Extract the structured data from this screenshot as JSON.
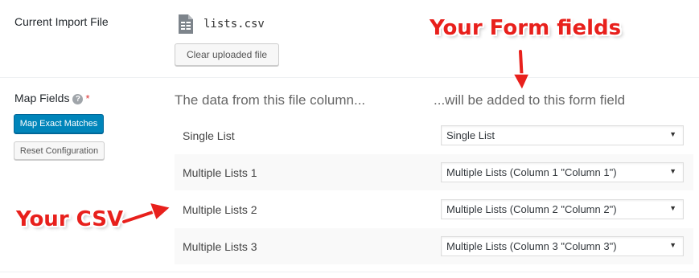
{
  "current_import": {
    "label": "Current Import File",
    "file_icon": "document-icon",
    "file_name": "lists.csv",
    "clear_button": "Clear uploaded file"
  },
  "map_fields": {
    "label": "Map Fields",
    "help_icon": "question-circle-icon",
    "help_glyph": "?",
    "required_marker": "*",
    "map_exact_button": "Map Exact Matches",
    "reset_button": "Reset Configuration",
    "column_header": "The data from this file column...",
    "field_header": "...will be added to this form field",
    "rows": [
      {
        "column": "Single List",
        "field": "Single List"
      },
      {
        "column": "Multiple Lists 1",
        "field": "Multiple Lists (Column 1 \"Column 1\")"
      },
      {
        "column": "Multiple Lists 2",
        "field": "Multiple Lists (Column 2 \"Column 2\")"
      },
      {
        "column": "Multiple Lists 3",
        "field": "Multiple Lists (Column 3 \"Column 3\")"
      }
    ],
    "select_caret": "▼"
  },
  "annotations": {
    "form_fields": "Your Form fields",
    "csv": "Your CSV",
    "color": "#e8201c"
  },
  "colors": {
    "primary_button": "#0085ba",
    "required": "#dc3232"
  }
}
